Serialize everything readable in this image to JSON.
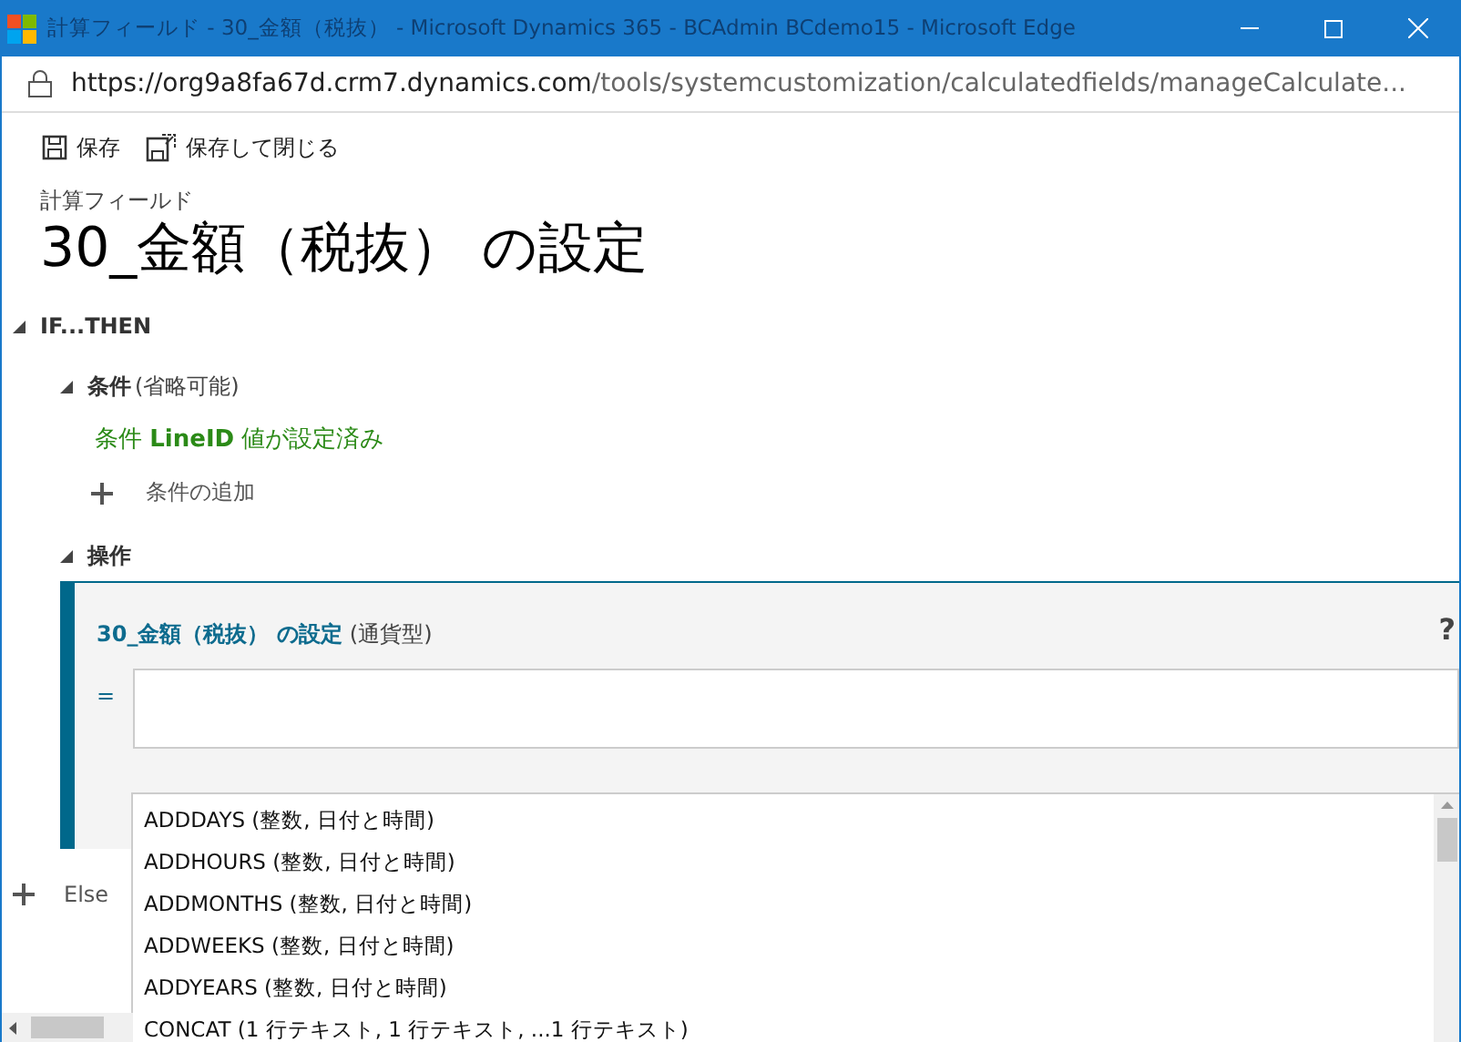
{
  "window": {
    "title": "計算フィールド - 30_金額（税抜） - Microsoft Dynamics 365 - BCAdmin BCdemo15 - Microsoft Edge"
  },
  "address_bar": {
    "host": "https://org9a8fa67d.crm7.dynamics.com",
    "path": "/tools/systemcustomization/calculatedfields/manageCalculate..."
  },
  "toolbar": [
    {
      "kind": "save",
      "label": "保存"
    },
    {
      "kind": "save_close",
      "label": "保存して閉じる"
    }
  ],
  "header": {
    "entity": "計算フィールド",
    "title": "30_金額（税抜） の設定"
  },
  "if_then": {
    "label": "IF...THEN",
    "expanded": true,
    "conditions": {
      "label": "条件",
      "hint": "(省略可能)",
      "expanded": true,
      "items": [
        {
          "prefix": "条件",
          "field": "LineID",
          "suffix": "値が設定済み"
        }
      ],
      "add_label": "条件の追加"
    },
    "actions": {
      "label": "操作",
      "expanded": true,
      "field": "30_金額（税抜） の設定",
      "type": "(通貨型)",
      "help": "?",
      "equals": "=",
      "suggestions": [
        "ADDDAYS (整数, 日付と時間)",
        "ADDHOURS (整数, 日付と時間)",
        "ADDMONTHS (整数, 日付と時間)",
        "ADDWEEKS (整数, 日付と時間)",
        "ADDYEARS (整数, 日付と時間)",
        "CONCAT (1 行テキスト, 1 行テキスト, ...1 行テキスト)"
      ]
    }
  },
  "else": {
    "label": "Else"
  }
}
